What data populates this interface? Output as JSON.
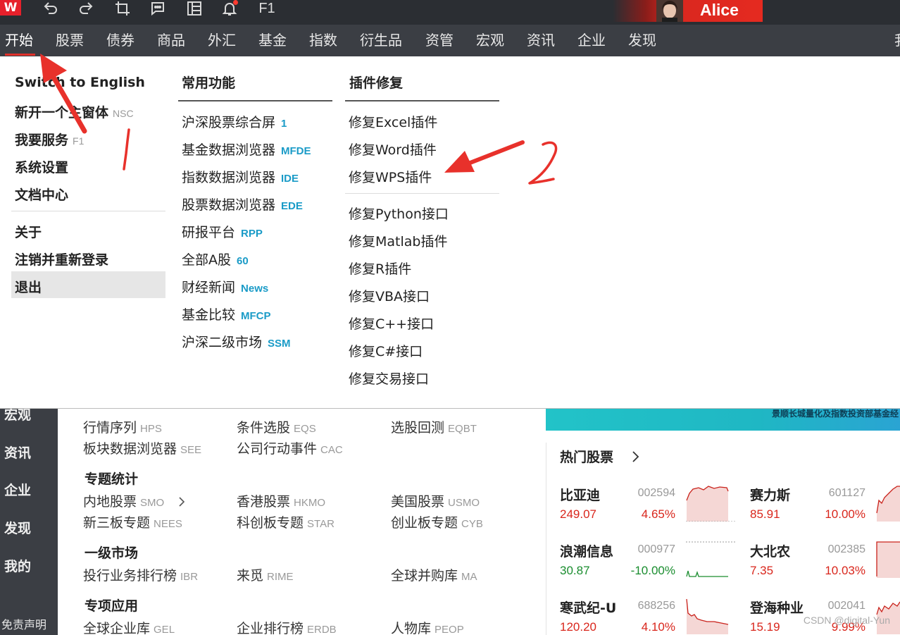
{
  "titlebar": {
    "logo": "W",
    "icons": [
      "undo-icon",
      "redo-icon",
      "crop-icon",
      "chat-icon",
      "panel-icon",
      "bell-icon"
    ],
    "f1_label": "F1",
    "user_name": "Alice",
    "accent_color": "#e52a20"
  },
  "topnav": {
    "items": [
      "开始",
      "股票",
      "债券",
      "商品",
      "外汇",
      "基金",
      "指数",
      "衍生品",
      "资管",
      "宏观",
      "资讯",
      "企业",
      "发现"
    ],
    "active": "开始",
    "overflow_char": "我"
  },
  "menu": {
    "col1": {
      "switch_english": "Switch to English",
      "new_window": "新开一个主窗体",
      "new_window_shortcut": "NSC",
      "service": "我要服务",
      "service_shortcut": "F1",
      "settings": "系统设置",
      "docs": "文档中心",
      "about": "关于",
      "logout": "注销并重新登录",
      "exit": "退出"
    },
    "col2": {
      "heading": "常用功能",
      "items": [
        {
          "label": "沪深股票综合屏",
          "code": "1"
        },
        {
          "label": "基金数据浏览器",
          "code": "MFDE"
        },
        {
          "label": "指数数据浏览器",
          "code": "IDE"
        },
        {
          "label": "股票数据浏览器",
          "code": "EDE"
        },
        {
          "label": "研报平台",
          "code": "RPP"
        },
        {
          "label": "全部A股",
          "code": "60"
        },
        {
          "label": "财经新闻",
          "code": "News"
        },
        {
          "label": "基金比较",
          "code": "MFCP"
        },
        {
          "label": "沪深二级市场",
          "code": "SSM"
        }
      ]
    },
    "col3": {
      "heading": "插件修复",
      "group1": [
        "修复Excel插件",
        "修复Word插件",
        "修复WPS插件"
      ],
      "group2": [
        "修复Python接口",
        "修复Matlab插件",
        "修复R插件",
        "修复VBA接口",
        "修复C++接口",
        "修复C#接口",
        "修复交易接口"
      ]
    }
  },
  "leftnav": {
    "items": [
      "宏观",
      "资讯",
      "企业",
      "发现",
      "我的"
    ],
    "footer": "免责声明"
  },
  "functions": {
    "row1": [
      {
        "label": "行情序列",
        "code": "HPS"
      },
      {
        "label": "条件选股",
        "code": "EQS"
      },
      {
        "label": "选股回测",
        "code": "EQBT"
      }
    ],
    "row2": [
      {
        "label": "板块数据浏览器",
        "code": "SEE"
      },
      {
        "label": "公司行动事件",
        "code": "CAC"
      }
    ],
    "section_topic": "专题统计",
    "row3": [
      {
        "label": "内地股票",
        "code": "SMO"
      },
      {
        "label": "香港股票",
        "code": "HKMO"
      },
      {
        "label": "美国股票",
        "code": "USMO"
      }
    ],
    "row4": [
      {
        "label": "新三板专题",
        "code": "NEES"
      },
      {
        "label": "科创板专题",
        "code": "STAR"
      },
      {
        "label": "创业板专题",
        "code": "CYB"
      }
    ],
    "section_primary": "一级市场",
    "row5": [
      {
        "label": "投行业务排行榜",
        "code": "IBR"
      },
      {
        "label": "来觅",
        "code": "RIME"
      },
      {
        "label": "全球并购库",
        "code": "MA"
      }
    ],
    "section_special": "专项应用",
    "row6": [
      {
        "label": "全球企业库",
        "code": "GEL"
      },
      {
        "label": "企业排行榜",
        "code": "ERDB"
      },
      {
        "label": "人物库",
        "code": "PEOP"
      }
    ]
  },
  "banner": {
    "text": "景顺长城量化及指数投资部基金经"
  },
  "hot_stocks": {
    "title": "热门股票",
    "stocks": [
      {
        "name": "比亚迪",
        "code": "002594",
        "price": "249.07",
        "pct": "4.65%",
        "direction": "up"
      },
      {
        "name": "赛力斯",
        "code": "601127",
        "price": "85.91",
        "pct": "10.00%",
        "direction": "up"
      },
      {
        "name": "浪潮信息",
        "code": "000977",
        "price": "30.87",
        "pct": "-10.00%",
        "direction": "down"
      },
      {
        "name": "大北农",
        "code": "002385",
        "price": "7.35",
        "pct": "10.03%",
        "direction": "up"
      },
      {
        "name": "寒武纪-U",
        "code": "688256",
        "price": "120.20",
        "pct": "4.10%",
        "direction": "up"
      },
      {
        "name": "登海种业",
        "code": "002041",
        "price": "15.19",
        "pct": "9.99%",
        "direction": "up"
      }
    ]
  },
  "annotations": {
    "label_1": "1",
    "label_2": "2",
    "color": "#e8312b"
  },
  "watermark": "CSDN @digital-Yun"
}
